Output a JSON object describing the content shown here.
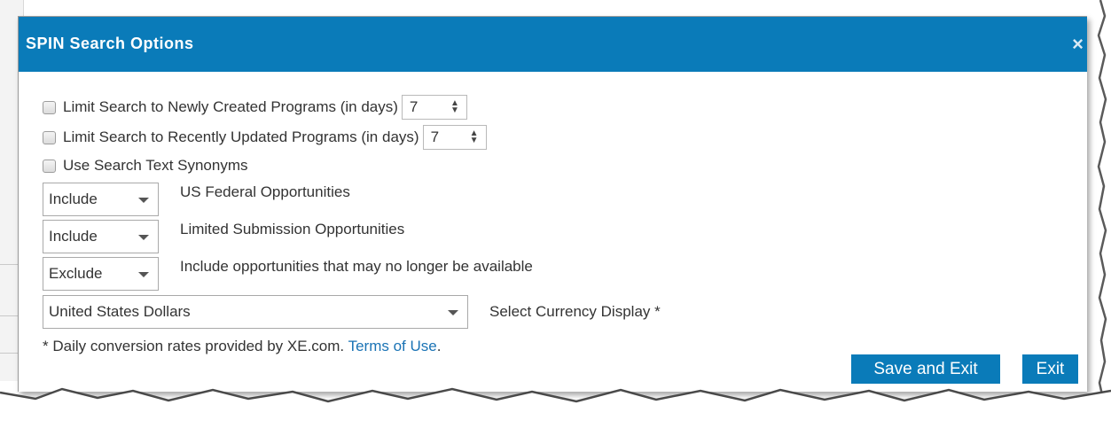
{
  "dialog": {
    "title": "SPIN Search Options",
    "close_glyph": "×"
  },
  "options": {
    "new_programs": {
      "label": "Limit Search to Newly Created Programs (in days)",
      "checked": false,
      "days": "7"
    },
    "updated_programs": {
      "label": "Limit Search to Recently Updated Programs (in days)",
      "checked": false,
      "days": "7"
    },
    "synonyms": {
      "label": "Use Search Text Synonyms",
      "checked": false
    }
  },
  "filters": [
    {
      "value": "Include",
      "label": "US Federal Opportunities"
    },
    {
      "value": "Include",
      "label": "Limited Submission Opportunities"
    },
    {
      "value": "Exclude",
      "label": "Include opportunities that may no longer be available"
    }
  ],
  "currency": {
    "value": "United States Dollars",
    "label": "Select Currency Display *",
    "note": "* Daily conversion rates provided by XE.com.",
    "terms_link": "Terms of Use",
    "terms_suffix": "."
  },
  "buttons": {
    "save_exit": "Save and Exit",
    "exit": "Exit"
  },
  "colors": {
    "header": "#0a7bb9",
    "button": "#0a7bb9",
    "link": "#1a73b5"
  },
  "icons": {
    "close": "close-icon",
    "spinner": "spinner-arrows-icon",
    "dropdown": "chevron-down-icon"
  }
}
